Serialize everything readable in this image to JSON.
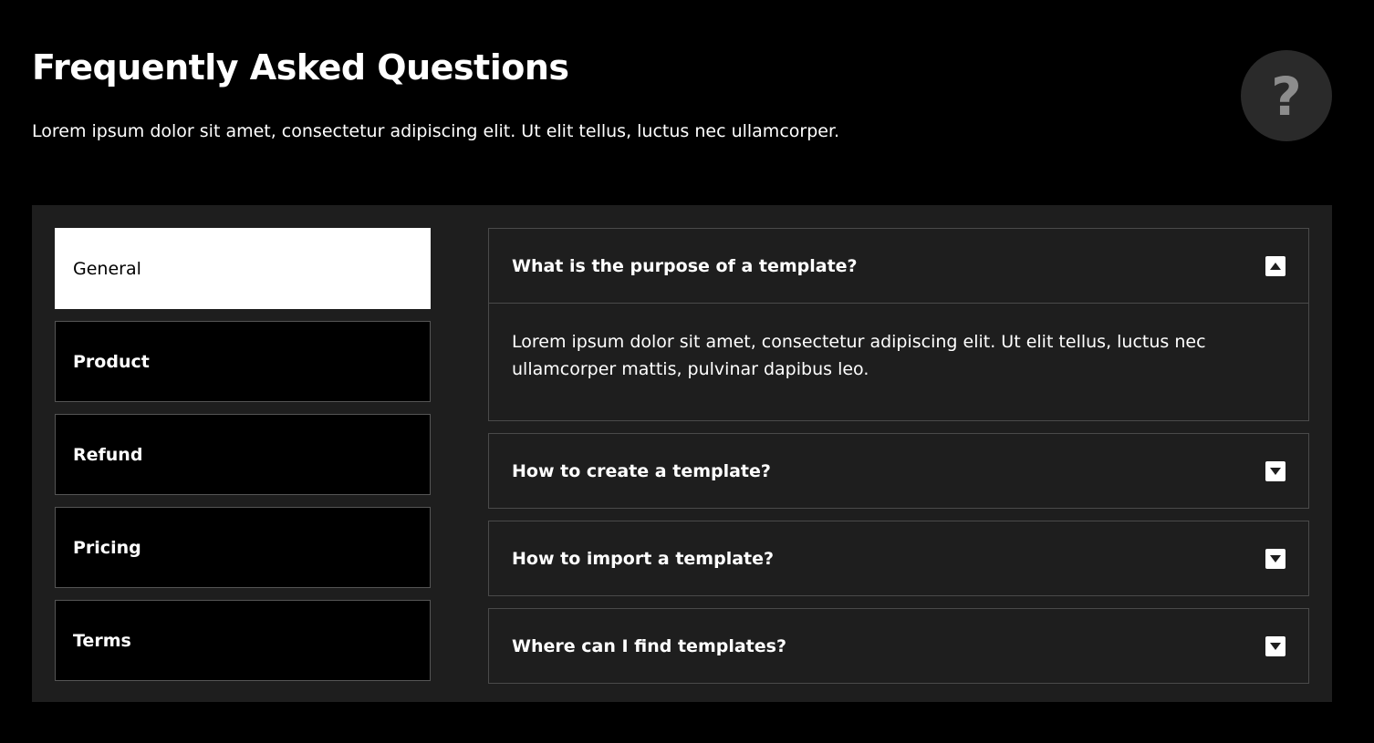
{
  "header": {
    "title": "Frequently Asked Questions",
    "subtitle": "Lorem ipsum dolor sit amet, consectetur adipiscing elit. Ut elit tellus, luctus nec ullamcorper.",
    "badge_glyph": "?",
    "badge_icon": "question-mark-icon"
  },
  "tabs": [
    {
      "label": "General",
      "active": true
    },
    {
      "label": "Product",
      "active": false
    },
    {
      "label": "Refund",
      "active": false
    },
    {
      "label": "Pricing",
      "active": false
    },
    {
      "label": "Terms",
      "active": false
    }
  ],
  "faq": [
    {
      "question": "What is the purpose of a template?",
      "answer": "Lorem ipsum dolor sit amet, consectetur adipiscing elit. Ut elit tellus, luctus nec ullamcorper mattis, pulvinar dapibus leo.",
      "expanded": true
    },
    {
      "question": "How to create a template?",
      "expanded": false
    },
    {
      "question": "How to import a template?",
      "expanded": false
    },
    {
      "question": "Where can I find templates?",
      "expanded": false
    }
  ],
  "colors": {
    "background": "#000000",
    "panel": "#1e1e1e",
    "active_tab": "#ffffff",
    "badge": "#2a2a2a"
  }
}
